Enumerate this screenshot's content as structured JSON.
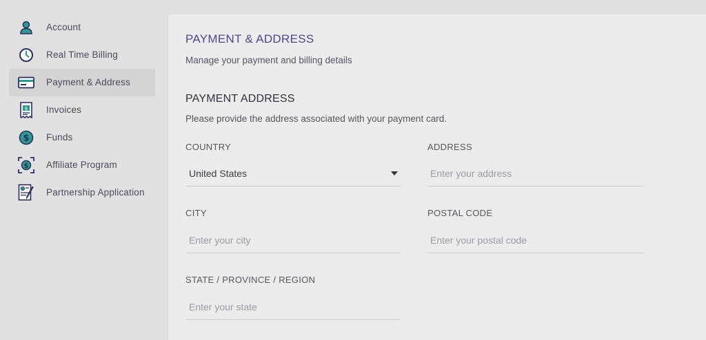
{
  "sidebar": {
    "items": [
      {
        "label": "Account",
        "icon": "user-icon"
      },
      {
        "label": "Real Time Billing",
        "icon": "clock-icon"
      },
      {
        "label": "Payment & Address",
        "icon": "credit-card-icon",
        "active": true
      },
      {
        "label": "Invoices",
        "icon": "invoice-icon"
      },
      {
        "label": "Funds",
        "icon": "dollar-coin-icon"
      },
      {
        "label": "Affiliate Program",
        "icon": "affiliate-icon"
      },
      {
        "label": "Partnership Application",
        "icon": "application-form-icon"
      }
    ]
  },
  "main": {
    "title": "PAYMENT & ADDRESS",
    "subtitle": "Manage your payment and billing details",
    "section_title": "PAYMENT ADDRESS",
    "section_desc": "Please provide the address associated with your payment card.",
    "fields": {
      "country": {
        "label": "COUNTRY",
        "value": "United States"
      },
      "address": {
        "label": "ADDRESS",
        "placeholder": "Enter your address"
      },
      "city": {
        "label": "CITY",
        "placeholder": "Enter your city"
      },
      "postal": {
        "label": "POSTAL CODE",
        "placeholder": "Enter your postal code"
      },
      "state": {
        "label": "STATE / PROVINCE / REGION",
        "placeholder": "Enter your state"
      }
    }
  },
  "colors": {
    "icon_teal": "#2a9d93",
    "icon_navy": "#2b2d5c",
    "title_purple": "#4e4689",
    "active_bg": "#d4d4d4"
  }
}
